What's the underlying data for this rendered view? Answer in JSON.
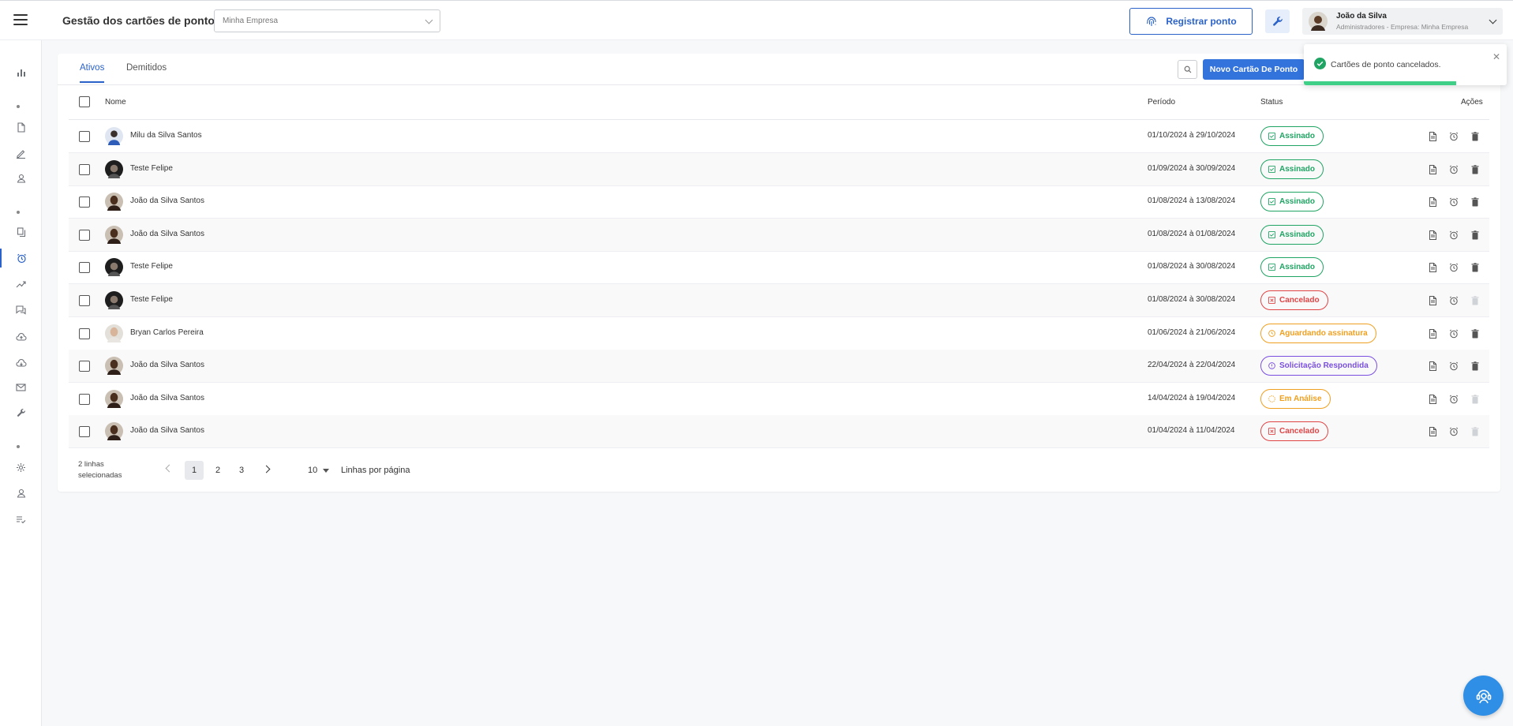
{
  "header": {
    "title": "Gestão dos cartões de ponto",
    "company_select": "Minha Empresa",
    "register_button": "Registrar ponto",
    "user_name": "João da Silva",
    "user_role": "Administradores - Empresa: Minha Empresa"
  },
  "tabs": [
    {
      "label": "Ativos",
      "active": true
    },
    {
      "label": "Demitidos",
      "active": false
    }
  ],
  "toolbar": {
    "new_button": "Novo Cartão De Ponto"
  },
  "columns": {
    "name": "Nome",
    "period": "Período",
    "status": "Status",
    "actions": "Ações"
  },
  "rows": [
    {
      "name": "Milu da Silva Santos",
      "period": "01/10/2024 à 29/10/2024",
      "status": "Assinado",
      "status_type": "signed",
      "avatar": "blue",
      "delete_enabled": true
    },
    {
      "name": "Teste Felipe",
      "period": "01/09/2024 à 30/09/2024",
      "status": "Assinado",
      "status_type": "signed",
      "avatar": "dark",
      "delete_enabled": true
    },
    {
      "name": "João da Silva Santos",
      "period": "01/08/2024 à 13/08/2024",
      "status": "Assinado",
      "status_type": "signed",
      "avatar": "brown",
      "delete_enabled": true
    },
    {
      "name": "João da Silva Santos",
      "period": "01/08/2024 à 01/08/2024",
      "status": "Assinado",
      "status_type": "signed",
      "avatar": "brown",
      "delete_enabled": true
    },
    {
      "name": "Teste Felipe",
      "period": "01/08/2024 à 30/08/2024",
      "status": "Assinado",
      "status_type": "signed",
      "avatar": "dark",
      "delete_enabled": true
    },
    {
      "name": "Teste Felipe",
      "period": "01/08/2024 à 30/08/2024",
      "status": "Cancelado",
      "status_type": "cancelled",
      "avatar": "dark",
      "delete_enabled": false
    },
    {
      "name": "Bryan Carlos Pereira",
      "period": "01/06/2024 à 21/06/2024",
      "status": "Aguardando assinatura",
      "status_type": "waiting",
      "avatar": "light",
      "delete_enabled": true
    },
    {
      "name": "João da Silva Santos",
      "period": "22/04/2024 à 22/04/2024",
      "status": "Solicitação Respondida",
      "status_type": "answered",
      "avatar": "brown",
      "delete_enabled": true
    },
    {
      "name": "João da Silva Santos",
      "period": "14/04/2024 à 19/04/2024",
      "status": "Em Análise",
      "status_type": "analysis",
      "avatar": "brown",
      "delete_enabled": false
    },
    {
      "name": "João da Silva Santos",
      "period": "01/04/2024 à 11/04/2024",
      "status": "Cancelado",
      "status_type": "cancelled",
      "avatar": "brown",
      "delete_enabled": false
    }
  ],
  "status_colors": {
    "signed": "#1fa463",
    "cancelled": "#e04545",
    "waiting": "#f0a020",
    "answered": "#7a4fe0",
    "analysis": "#f0a020"
  },
  "footer": {
    "selected_text": "2 linhas selecionadas",
    "pages": [
      "1",
      "2",
      "3"
    ],
    "current_page": "1",
    "rows_per_page_value": "10",
    "rows_per_page_label": "Linhas por página"
  },
  "toast": {
    "message": "Cartões de ponto cancelados.",
    "type": "success"
  },
  "sidebar_icons": [
    "bar-chart-icon",
    "document-icon",
    "pen-icon",
    "user-icon",
    "copy-icon",
    "alarm-clock-icon",
    "trend-icon",
    "chat-icon",
    "cloud-upload-icon",
    "cloud-download-icon",
    "mail-icon",
    "wrench-icon",
    "gear-icon",
    "user-icon",
    "checklist-icon"
  ],
  "accent_color": "#2a62c9"
}
